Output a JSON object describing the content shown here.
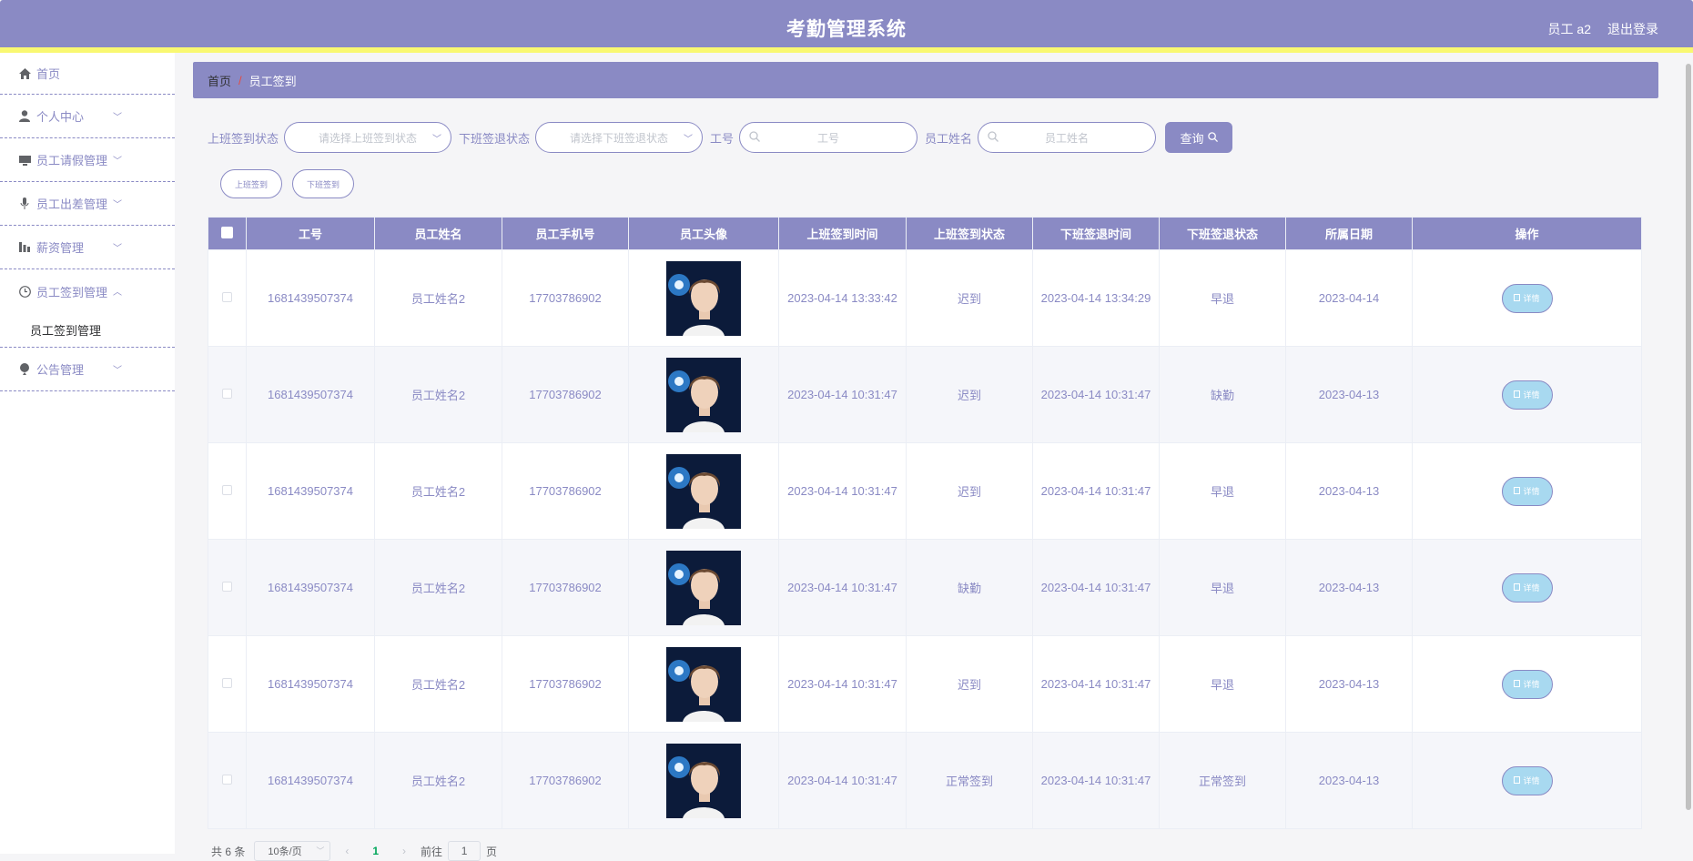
{
  "header": {
    "title": "考勤管理系统",
    "user": "员工 a2",
    "logout": "退出登录"
  },
  "sidebar": {
    "items": [
      {
        "label": "首页",
        "icon": "home-icon",
        "expandable": false
      },
      {
        "label": "个人中心",
        "icon": "user-icon",
        "expandable": true
      },
      {
        "label": "员工请假管理",
        "icon": "monitor-icon",
        "expandable": true
      },
      {
        "label": "员工出差管理",
        "icon": "mic-icon",
        "expandable": true
      },
      {
        "label": "薪资管理",
        "icon": "bar-chart-icon",
        "expandable": true
      },
      {
        "label": "员工签到管理",
        "icon": "clock-icon",
        "expandable": true,
        "expanded": true
      },
      {
        "label": "公告管理",
        "icon": "balloon-icon",
        "expandable": true
      }
    ],
    "submenu_label": "员工签到管理"
  },
  "breadcrumb": {
    "home": "首页",
    "separator": "/",
    "current": "员工签到"
  },
  "filters": {
    "checkin_label": "上班签到状态",
    "checkin_placeholder": "请选择上班签到状态",
    "checkout_label": "下班签退状态",
    "checkout_placeholder": "请选择下班签退状态",
    "id_label": "工号",
    "id_placeholder": "工号",
    "name_label": "员工姓名",
    "name_placeholder": "员工姓名",
    "query_button": "查询"
  },
  "actions": {
    "checkin": "上班签到",
    "checkout": "下班签到"
  },
  "table": {
    "columns": [
      "工号",
      "员工姓名",
      "员工手机号",
      "员工头像",
      "上班签到时间",
      "上班签到状态",
      "下班签退时间",
      "下班签退状态",
      "所属日期",
      "操作"
    ],
    "detail_label": "详情",
    "rows": [
      {
        "id": "1681439507374",
        "name": "员工姓名2",
        "phone": "17703786902",
        "checkin_time": "2023-04-14 13:33:42",
        "checkin_status": "迟到",
        "checkout_time": "2023-04-14 13:34:29",
        "checkout_status": "早退",
        "date": "2023-04-14"
      },
      {
        "id": "1681439507374",
        "name": "员工姓名2",
        "phone": "17703786902",
        "checkin_time": "2023-04-14 10:31:47",
        "checkin_status": "迟到",
        "checkout_time": "2023-04-14 10:31:47",
        "checkout_status": "缺勤",
        "date": "2023-04-13"
      },
      {
        "id": "1681439507374",
        "name": "员工姓名2",
        "phone": "17703786902",
        "checkin_time": "2023-04-14 10:31:47",
        "checkin_status": "迟到",
        "checkout_time": "2023-04-14 10:31:47",
        "checkout_status": "早退",
        "date": "2023-04-13"
      },
      {
        "id": "1681439507374",
        "name": "员工姓名2",
        "phone": "17703786902",
        "checkin_time": "2023-04-14 10:31:47",
        "checkin_status": "缺勤",
        "checkout_time": "2023-04-14 10:31:47",
        "checkout_status": "早退",
        "date": "2023-04-13"
      },
      {
        "id": "1681439507374",
        "name": "员工姓名2",
        "phone": "17703786902",
        "checkin_time": "2023-04-14 10:31:47",
        "checkin_status": "迟到",
        "checkout_time": "2023-04-14 10:31:47",
        "checkout_status": "早退",
        "date": "2023-04-13"
      },
      {
        "id": "1681439507374",
        "name": "员工姓名2",
        "phone": "17703786902",
        "checkin_time": "2023-04-14 10:31:47",
        "checkin_status": "正常签到",
        "checkout_time": "2023-04-14 10:31:47",
        "checkout_status": "正常签到",
        "date": "2023-04-13"
      }
    ]
  },
  "pagination": {
    "total": "共 6 条",
    "page_size": "10条/页",
    "current_page": "1",
    "goto_label": "前往",
    "goto_value": "1",
    "page_suffix": "页"
  },
  "colors": {
    "accent": "#8a8ac4",
    "stripe": "#f9f871",
    "detail_button": "#a8d9f0"
  }
}
